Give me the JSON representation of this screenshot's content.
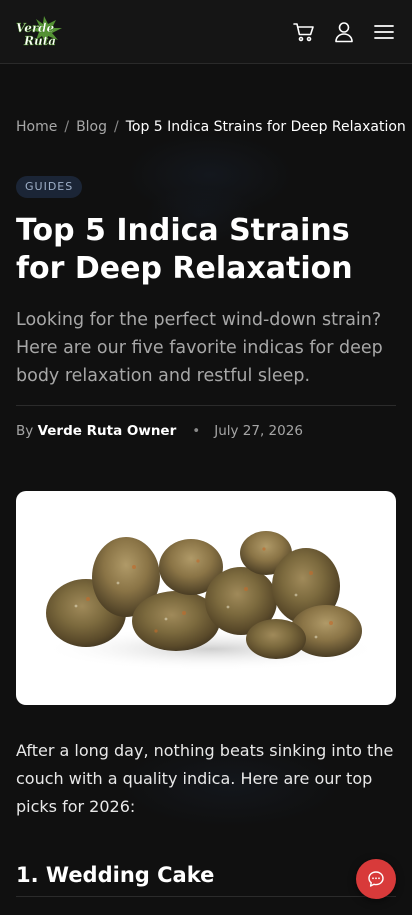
{
  "header": {
    "logo_text": "Verde Ruta",
    "icons": [
      "cart-icon",
      "account-icon",
      "menu-icon"
    ]
  },
  "breadcrumb": {
    "home": "Home",
    "blog": "Blog",
    "current": "Top 5 Indica Strains for Deep Relaxation",
    "separator": "/"
  },
  "article": {
    "category": "GUIDES",
    "title": "Top 5 Indica Strains for Deep Relaxation",
    "lede": "Looking for the perfect wind-down strain? Here are our five favorite indicas for deep body relaxation and restful sleep.",
    "by_label": "By",
    "author": "Verde Ruta Owner",
    "dot": "•",
    "date": "July 27, 2026",
    "intro": "After a long day, nothing beats sinking into the couch with a quality indica. Here are our top picks for 2026:",
    "first_heading": "1. Wedding Cake"
  },
  "colors": {
    "background": "#101010",
    "header": "#151515",
    "accent": "#d83a3a",
    "badge_bg": "#1b2536",
    "logo_green": "#7bc142"
  },
  "chat": {
    "icon": "chat-icon"
  }
}
